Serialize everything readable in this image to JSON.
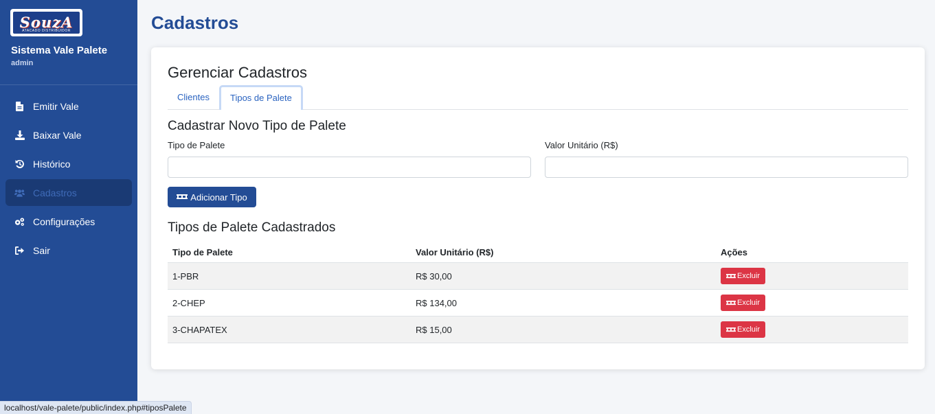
{
  "sidebar": {
    "logo_text": "SouzA",
    "logo_sub": "ATACADO DISTRIBUIDOR",
    "title": "Sistema Vale Palete",
    "user": "admin",
    "items": [
      {
        "label": "Emitir Vale",
        "icon": "file-icon"
      },
      {
        "label": "Baixar Vale",
        "icon": "download-icon"
      },
      {
        "label": "Histórico",
        "icon": "history-icon"
      },
      {
        "label": "Cadastros",
        "icon": "users-icon",
        "active": true
      },
      {
        "label": "Configurações",
        "icon": "gears-icon"
      },
      {
        "label": "Sair",
        "icon": "sign-out-icon"
      }
    ]
  },
  "page": {
    "title": "Cadastros"
  },
  "card": {
    "title": "Gerenciar Cadastros",
    "tabs": [
      {
        "label": "Clientes"
      },
      {
        "label": "Tipos de Palete",
        "active": true
      }
    ],
    "form": {
      "title": "Cadastrar Novo Tipo de Palete",
      "tipo_label": "Tipo de Palete",
      "tipo_value": "",
      "valor_label": "Valor Unitário (R$)",
      "valor_value": "",
      "add_button": "Adicionar Tipo"
    },
    "list": {
      "title": "Tipos de Palete Cadastrados",
      "headers": [
        "Tipo de Palete",
        "Valor Unitário (R$)",
        "Ações"
      ],
      "rows": [
        {
          "tipo": "1-PBR",
          "valor": "R$ 30,00",
          "action": "Excluir"
        },
        {
          "tipo": "2-CHEP",
          "valor": "R$ 134,00",
          "action": "Excluir"
        },
        {
          "tipo": "3-CHAPATEX",
          "valor": "R$ 15,00",
          "action": "Excluir"
        }
      ]
    }
  },
  "statusbar": {
    "url": "localhost/vale-palete/public/index.php#tiposPalete"
  },
  "colors": {
    "sidebar": "#234c95",
    "primary": "#234c95",
    "danger": "#dc3545",
    "link": "#2a63c0"
  }
}
